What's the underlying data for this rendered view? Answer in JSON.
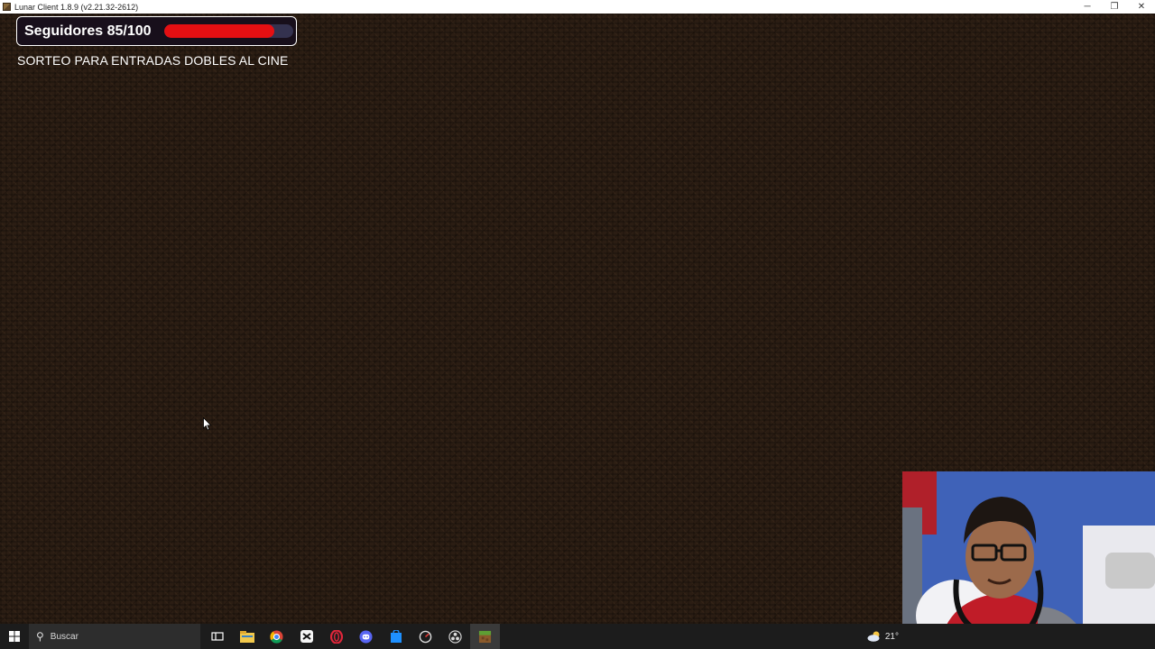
{
  "window": {
    "title": "Lunar Client 1.8.9 (v2.21.32-2612)",
    "minimize_glyph": "─",
    "restore_glyph": "❐",
    "close_glyph": "✕"
  },
  "overlay": {
    "followers_label": "Seguidores 85/100",
    "followers_current": 85,
    "followers_goal": 100,
    "progress_fraction": 0.85,
    "progress_color": "#e50f12",
    "track_color": "#34324f",
    "giveaway_text": "SORTEO PARA ENTRADAS DOBLES AL CINE"
  },
  "taskbar": {
    "search_placeholder": "Buscar",
    "apps": [
      {
        "name": "task-view-icon"
      },
      {
        "name": "file-explorer-icon"
      },
      {
        "name": "chrome-icon"
      },
      {
        "name": "capcut-icon"
      },
      {
        "name": "opera-gx-icon"
      },
      {
        "name": "discord-icon"
      },
      {
        "name": "store-icon"
      },
      {
        "name": "speedometer-icon"
      },
      {
        "name": "obs-icon"
      },
      {
        "name": "minecraft-icon"
      }
    ],
    "weather_temp": "21°"
  },
  "colors": {
    "dirt_background": "#2b1d13",
    "taskbar": "#1c1c1c"
  }
}
